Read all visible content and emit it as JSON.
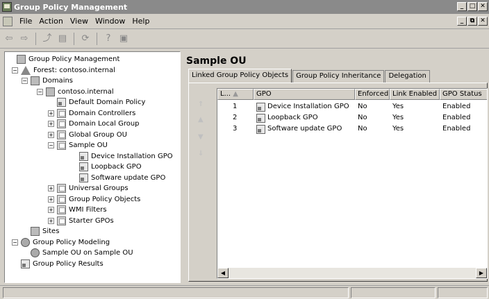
{
  "window": {
    "title": "Group Policy Management"
  },
  "window_buttons": [
    "_",
    "□",
    "✕"
  ],
  "menubar": {
    "items": [
      "File",
      "Action",
      "View",
      "Window",
      "Help"
    ]
  },
  "mdi_buttons": [
    "_",
    "⧉",
    "✕"
  ],
  "toolbar": {
    "buttons": [
      "back-icon",
      "forward-icon",
      "up-icon",
      "show-hide-tree-icon",
      "refresh-icon",
      "help-icon",
      "properties-icon"
    ]
  },
  "tree": {
    "items": [
      {
        "label": "Group Policy Management",
        "icon": "gpm-icon",
        "level": 0,
        "expander": ""
      },
      {
        "label": "Forest: contoso.internal",
        "icon": "forest-icon",
        "level": 1,
        "expander": "−"
      },
      {
        "label": "Domains",
        "icon": "domains-icon",
        "level": 2,
        "expander": "−"
      },
      {
        "label": "contoso.internal",
        "icon": "domain-icon",
        "level": 3,
        "expander": "−"
      },
      {
        "label": "Default Domain Policy",
        "icon": "gpo-link-icon",
        "level": 4,
        "expander": ""
      },
      {
        "label": "Domain Controllers",
        "icon": "ou-icon",
        "level": 4,
        "expander": "+"
      },
      {
        "label": "Domain Local Group",
        "icon": "ou-icon",
        "level": 4,
        "expander": "+"
      },
      {
        "label": "Global Group OU",
        "icon": "ou-icon",
        "level": 4,
        "expander": "+"
      },
      {
        "label": "Sample OU",
        "icon": "ou-icon",
        "level": 4,
        "expander": "−"
      },
      {
        "label": "Device Installation GPO",
        "icon": "gpo-link-icon",
        "level": 5,
        "expander": ""
      },
      {
        "label": "Loopback GPO",
        "icon": "gpo-link-icon",
        "level": 5,
        "expander": ""
      },
      {
        "label": "Software update GPO",
        "icon": "gpo-link-icon",
        "level": 5,
        "expander": ""
      },
      {
        "label": "Universal Groups",
        "icon": "ou-icon",
        "level": 4,
        "expander": "+"
      },
      {
        "label": "Group Policy Objects",
        "icon": "gpo-container-icon",
        "level": 4,
        "expander": "+"
      },
      {
        "label": "WMI Filters",
        "icon": "wmi-filter-icon",
        "level": 4,
        "expander": "+"
      },
      {
        "label": "Starter GPOs",
        "icon": "starter-gpo-icon",
        "level": 4,
        "expander": "+"
      },
      {
        "label": "Sites",
        "icon": "sites-icon",
        "level": 2,
        "expander": ""
      },
      {
        "label": "Group Policy Modeling",
        "icon": "modeling-icon",
        "level": 1,
        "expander": "−"
      },
      {
        "label": "Sample OU on Sample OU",
        "icon": "modeling-result-icon",
        "level": 2,
        "expander": ""
      },
      {
        "label": "Group Policy Results",
        "icon": "results-icon",
        "level": 1,
        "expander": ""
      }
    ]
  },
  "main": {
    "title": "Sample OU",
    "tabs": [
      "Linked Group Policy Objects",
      "Group Policy Inheritance",
      "Delegation"
    ],
    "active_tab": 0,
    "side_arrows": [
      "⇑",
      "▲",
      "▼",
      "⇓"
    ],
    "table": {
      "headers": [
        "L...",
        "GPO",
        "Enforced",
        "Link Enabled",
        "GPO Status"
      ],
      "sort_indicator": "▲",
      "rows": [
        {
          "order": "1",
          "gpo": "Device Installation GPO",
          "enforced": "No",
          "link_enabled": "Yes",
          "status": "Enabled"
        },
        {
          "order": "2",
          "gpo": "Loopback GPO",
          "enforced": "No",
          "link_enabled": "Yes",
          "status": "Enabled"
        },
        {
          "order": "3",
          "gpo": "Software update GPO",
          "enforced": "No",
          "link_enabled": "Yes",
          "status": "Enabled"
        }
      ]
    },
    "scroll_left": "◀",
    "scroll_right": "▶"
  },
  "colors": {
    "titlebar": "#8a8a8a",
    "chrome": "#d4d0c8",
    "pane": "#ffffff"
  }
}
